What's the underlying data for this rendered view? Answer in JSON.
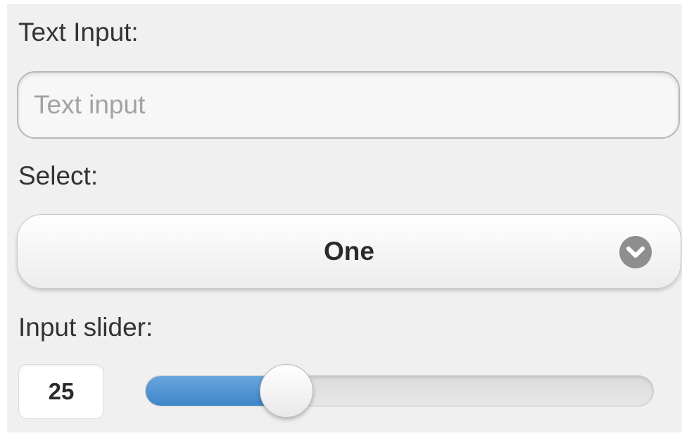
{
  "text_input": {
    "label": "Text Input:",
    "placeholder": "Text input",
    "value": ""
  },
  "select": {
    "label": "Select:",
    "selected": "One",
    "icon": "chevron-down-circle-icon"
  },
  "slider": {
    "label": "Input slider:",
    "value": "25",
    "min": 0,
    "max": 100,
    "fill_color": "#4a90d2"
  }
}
